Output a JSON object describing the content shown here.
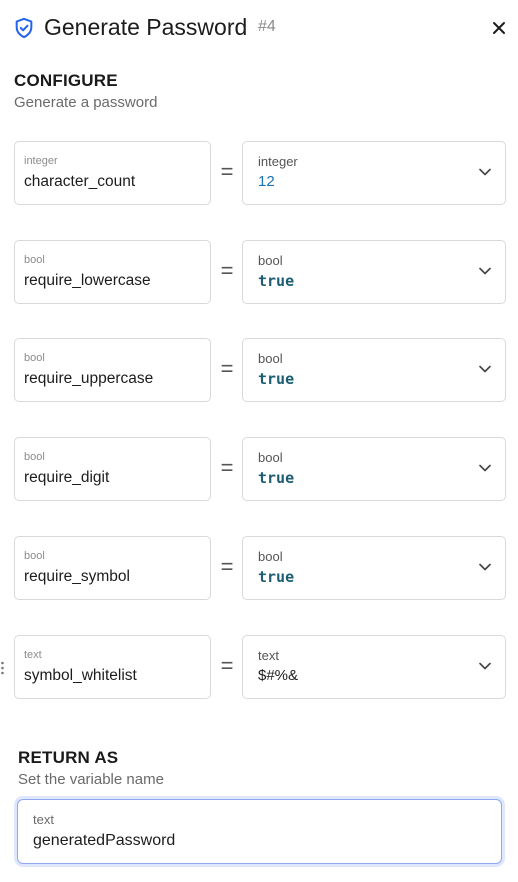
{
  "header": {
    "title": "Generate Password",
    "badge": "#4",
    "icon": "shield-check-icon",
    "close_icon": "close-icon",
    "accent": "#2563eb"
  },
  "configure": {
    "title": "CONFIGURE",
    "subtitle": "Generate a password"
  },
  "params": [
    {
      "type": "integer",
      "name": "character_count",
      "value_type": "integer",
      "value": "12",
      "kind": "num"
    },
    {
      "type": "bool",
      "name": "require_lowercase",
      "value_type": "bool",
      "value": "true",
      "kind": "bool"
    },
    {
      "type": "bool",
      "name": "require_uppercase",
      "value_type": "bool",
      "value": "true",
      "kind": "bool"
    },
    {
      "type": "bool",
      "name": "require_digit",
      "value_type": "bool",
      "value": "true",
      "kind": "bool"
    },
    {
      "type": "bool",
      "name": "require_symbol",
      "value_type": "bool",
      "value": "true",
      "kind": "bool"
    },
    {
      "type": "text",
      "name": "symbol_whitelist",
      "value_type": "text",
      "value": "$#%&",
      "kind": "text"
    }
  ],
  "equals": "=",
  "return_as": {
    "title": "RETURN AS",
    "subtitle": "Set the variable name",
    "field_type": "text",
    "value": "generatedPassword"
  }
}
